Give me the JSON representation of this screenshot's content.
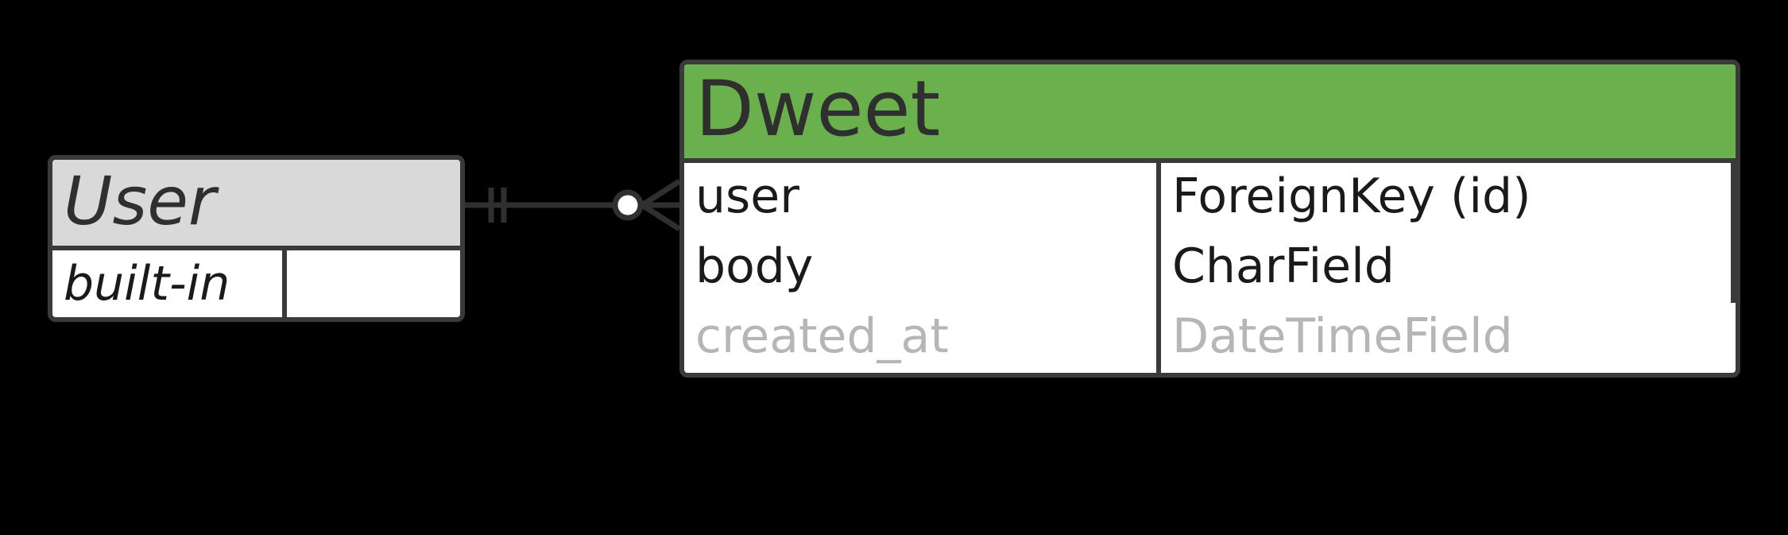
{
  "entities": {
    "user": {
      "title": "User",
      "rows": [
        {
          "name": "built-in",
          "type": ""
        }
      ]
    },
    "dweet": {
      "title": "Dweet",
      "rows": [
        {
          "name": "user",
          "type": "ForeignKey (id)",
          "muted": false
        },
        {
          "name": "body",
          "type": "CharField",
          "muted": false
        },
        {
          "name": "created_at",
          "type": "DateTimeField",
          "muted": true
        }
      ]
    }
  },
  "relation": {
    "from": "user",
    "to": "dweet",
    "to_field": "user",
    "cardinality": "one-to-many-optional"
  }
}
